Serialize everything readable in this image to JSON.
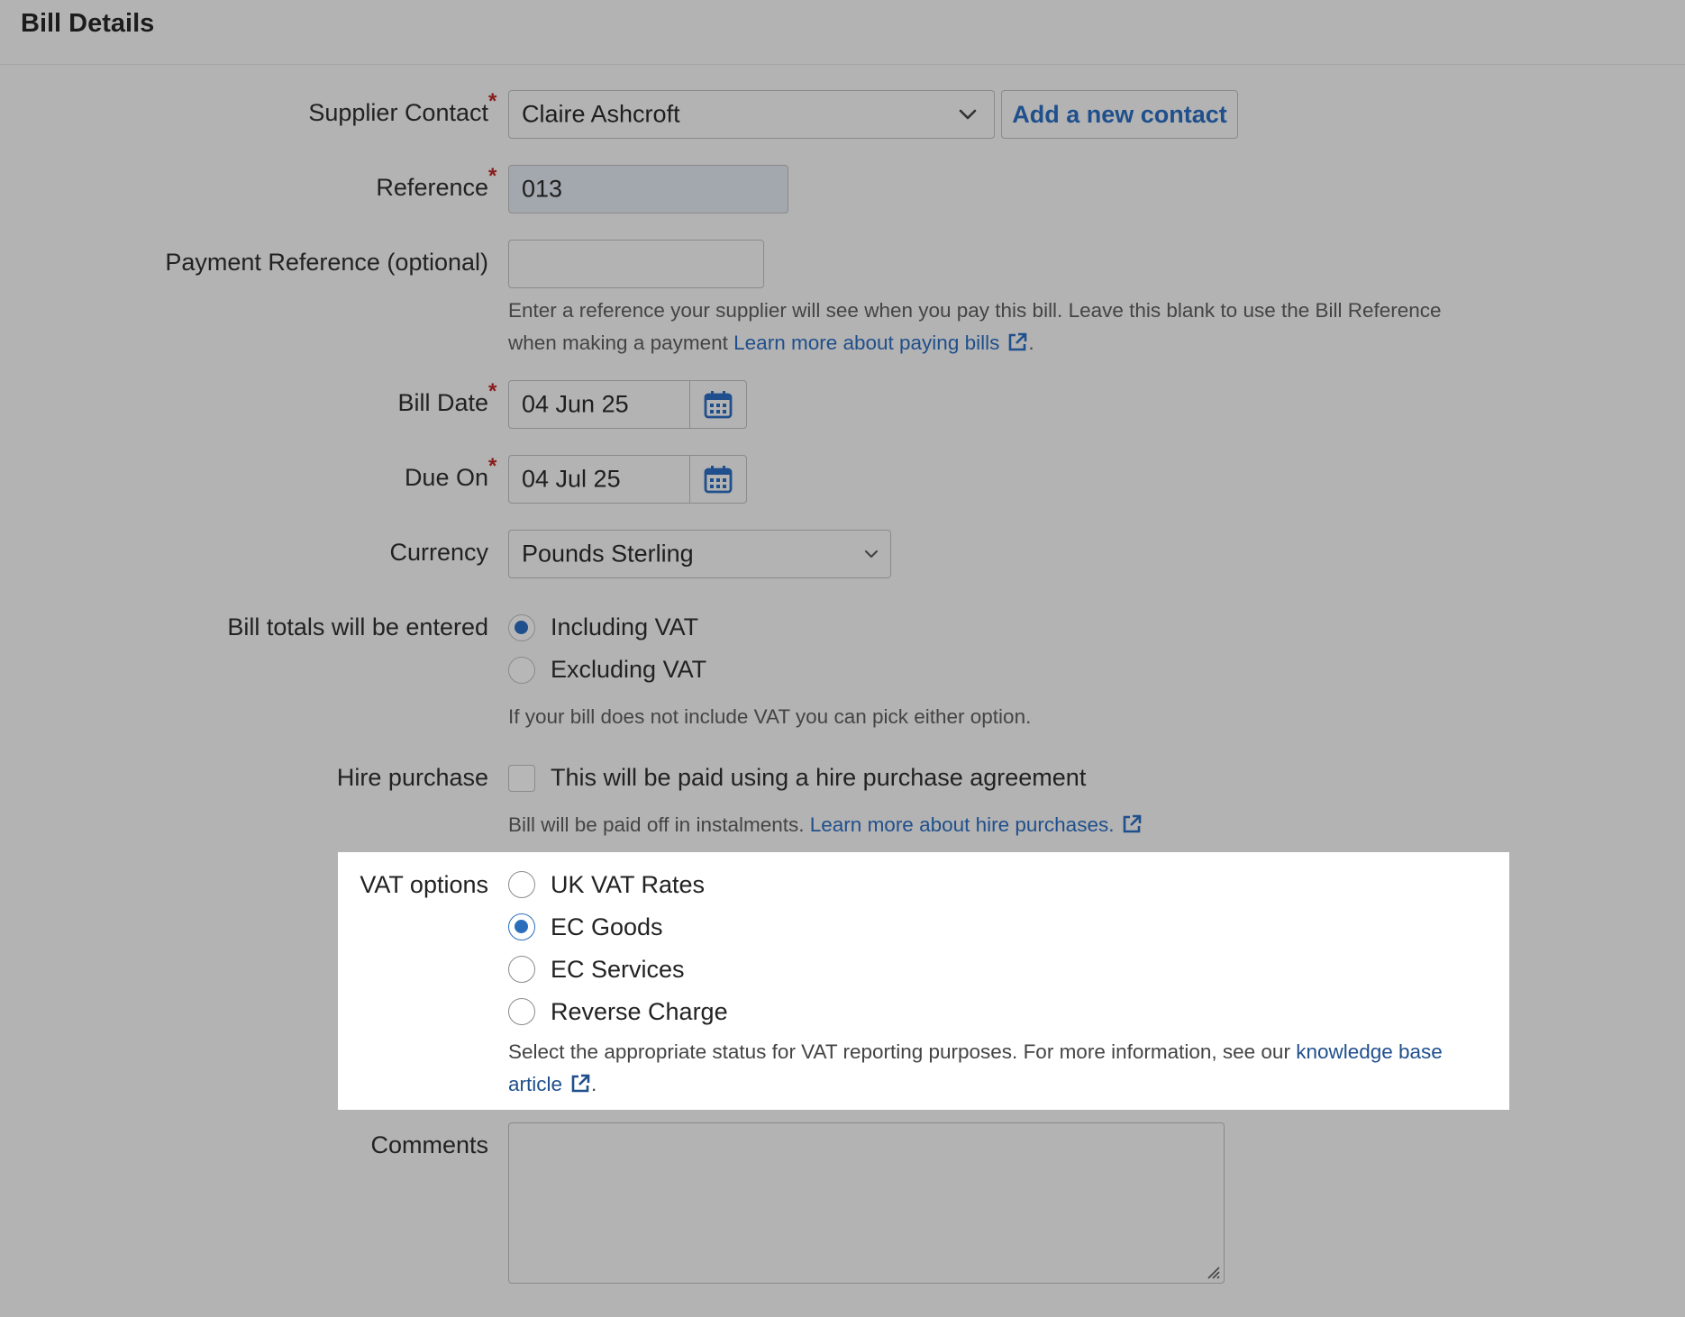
{
  "header": {
    "title": "Bill Details"
  },
  "supplier": {
    "label": "Supplier Contact",
    "required_mark": "*",
    "value": "Claire Ashcroft",
    "add_button": "Add a new contact"
  },
  "reference": {
    "label": "Reference",
    "required_mark": "*",
    "value": "013"
  },
  "payment_reference": {
    "label": "Payment Reference (optional)",
    "value": "",
    "help_line1": "Enter a reference your supplier will see when you pay this bill. Leave this blank to use the Bill Reference",
    "help_line2": "when making a payment",
    "help_link": "Learn more about paying bills",
    "help_end": "."
  },
  "bill_date": {
    "label": "Bill Date",
    "required_mark": "*",
    "value": "04 Jun 25"
  },
  "due_on": {
    "label": "Due On",
    "required_mark": "*",
    "value": "04 Jul 25"
  },
  "currency": {
    "label": "Currency",
    "value": "Pounds Sterling"
  },
  "totals": {
    "label": "Bill totals will be entered",
    "options": [
      "Including VAT",
      "Excluding VAT"
    ],
    "selected": "Including VAT",
    "help": "If your bill does not include VAT you can pick either option."
  },
  "hire_purchase": {
    "label": "Hire purchase",
    "checkbox_label": "This will be paid using a hire purchase agreement",
    "checked": false,
    "help": "Bill will be paid off in instalments.",
    "help_link": "Learn more about hire purchases."
  },
  "vat_options": {
    "label": "VAT options",
    "options": [
      "UK VAT Rates",
      "EC Goods",
      "EC Services",
      "Reverse Charge"
    ],
    "selected": "EC Goods",
    "help_line1": "Select the appropriate status for VAT reporting purposes. For more information, see our",
    "help_link1": "knowledge base",
    "help_link2": "article",
    "help_end": "."
  },
  "comments": {
    "label": "Comments",
    "value": ""
  },
  "colors": {
    "accent": "#1f4f8c",
    "radio_selected_dim": "#1f4f8c",
    "radio_selected_bright": "#2a6ebb",
    "required": "#8b1a1a",
    "page_bg": "#b3b3b3",
    "highlight_bg": "#ffffff"
  },
  "icons": {
    "select": "chevron-down-icon",
    "date": "calendar-icon",
    "link": "external-link-icon"
  }
}
